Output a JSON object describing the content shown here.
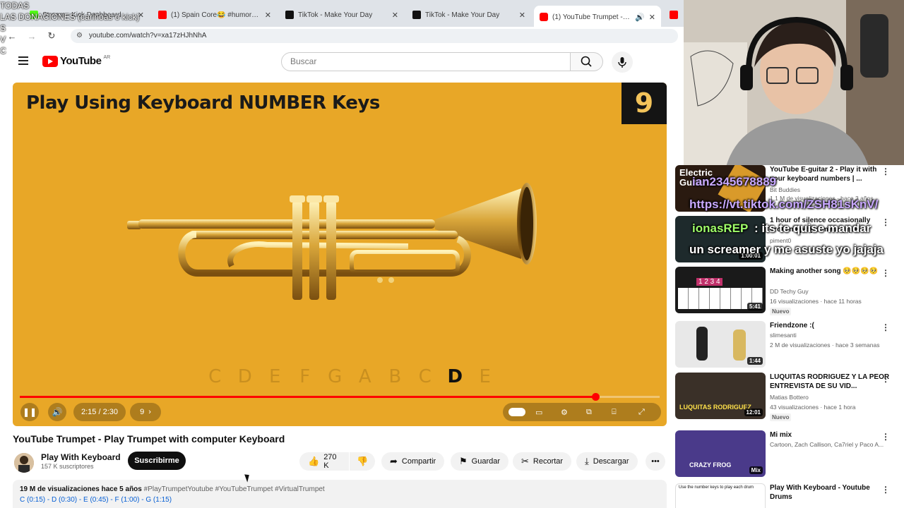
{
  "browser": {
    "tabs": [
      {
        "title": "Stream - Kick Dashboard",
        "active": false
      },
      {
        "title": "(1) Spain Core😂 #humor #esp",
        "active": false
      },
      {
        "title": "TikTok - Make Your Day",
        "active": false
      },
      {
        "title": "TikTok - Make Your Day",
        "active": false
      },
      {
        "title": "(1) YouTube Trumpet - Play",
        "active": true
      }
    ],
    "url": "youtube.com/watch?v=xa17zHJhNhA"
  },
  "stream_overlay": {
    "lines": [
      "TODAS",
      "LAS DONACIONES (cariñoas o kick)",
      "S",
      "V",
      "C"
    ]
  },
  "header": {
    "logo_text": "YouTube",
    "logo_country": "AR",
    "search_placeholder": "Buscar"
  },
  "player": {
    "overlay_title": "Play Using Keyboard NUMBER Keys",
    "number_badge": "9",
    "notes": [
      "C",
      "D",
      "E",
      "F",
      "G",
      "A",
      "B",
      "C",
      "D",
      "E"
    ],
    "current_note_index": 8,
    "time": "2:15 / 2:30",
    "chapter": "9",
    "progress_fraction": 0.9,
    "accent_color": "#ff0000",
    "bg_color": "#e8a727"
  },
  "video": {
    "title": "YouTube Trumpet - Play Trumpet with computer Keyboard",
    "channel": "Play With Keyboard",
    "subscribers": "157 K suscriptores",
    "subscribe_label": "Suscribirme",
    "likes": "270 K",
    "share_label": "Compartir",
    "save_label": "Guardar",
    "clip_label": "Recortar",
    "download_label": "Descargar",
    "desc_meta": "19 M de visualizaciones  hace 5 años",
    "desc_tags": "#PlayTrumpetYoutube #YouTubeTrumpet #VirtualTrumpet",
    "desc_line2": "C (0:15) - D (0:30) - E (0:45) - F (1:00) - G (1:15)"
  },
  "recommendations": [
    {
      "title": "YouTube E-guitar 2 - Play it with your keyboard numbers | ...",
      "channel": "Bit Buddies",
      "meta": "1,1 M de visualizaciones · hace 3 años",
      "duration": "",
      "badge": "",
      "thumb_label": "Electric Guitar"
    },
    {
      "title": "1 hour of silence occasionally broken up by a metal pipe...",
      "channel": "piment0",
      "meta": "",
      "duration": "1:00:01",
      "badge": "",
      "thumb_label": ""
    },
    {
      "title": "Making another song 🥺🥺🥺🥺",
      "channel": "DD Techy Guy",
      "meta": "16 visualizaciones · hace 11 horas",
      "duration": "5:41",
      "badge": "Nuevo",
      "thumb_label": "1 2 3 4"
    },
    {
      "title": "Friendzone :(",
      "channel": "slimesanti",
      "meta": "2 M de visualizaciones · hace 3 semanas",
      "duration": "1:44",
      "badge": "",
      "thumb_label": ""
    },
    {
      "title": "LUQUITAS RODRIGUEZ Y LA PEOR ENTREVISTA DE SU VID...",
      "channel": "Matias Bottero",
      "meta": "43 visualizaciones · hace 1 hora",
      "duration": "12:01",
      "badge": "Nuevo",
      "thumb_label": "LUQUITAS RODRIGUEZ"
    },
    {
      "title": "Mi mix",
      "channel": "Cartoon, Zach Callison, Ca7riel y Paco A...",
      "meta": "",
      "duration": "Mix",
      "badge": "",
      "thumb_label": "CRAZY FROG"
    },
    {
      "title": "Play With Keyboard - Youtube Drums",
      "channel": "",
      "meta": "",
      "duration": "",
      "badge": "",
      "thumb_label": "Use the number keys to play each drum"
    }
  ],
  "chat_overlay": {
    "line1": "ian2345678889",
    "line2": "https://vt.tiktok.com/ZSH81sKnV/",
    "user": "ionasREP",
    "msg1": ": its te quise mandar",
    "msg2": "un screamer y me asuste yo jajaja"
  }
}
